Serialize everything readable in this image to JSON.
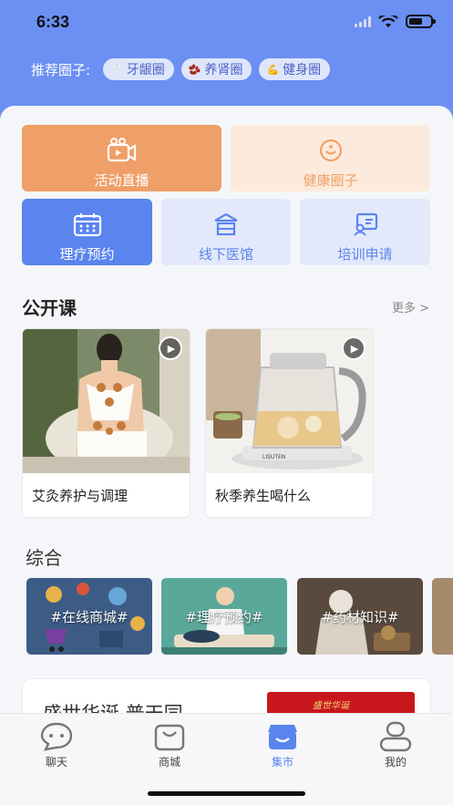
{
  "status_bar": {
    "time": "6:33"
  },
  "recommend": {
    "label": "推荐圈子:",
    "chips": [
      {
        "icon": "tooth-icon",
        "label": "牙龈圈"
      },
      {
        "icon": "kidney-icon",
        "label": "养肾圈"
      },
      {
        "icon": "fitness-icon",
        "label": "健身圈"
      }
    ]
  },
  "tiles": [
    {
      "label": "活动直播",
      "icon": "live-camera-icon"
    },
    {
      "label": "健康圈子",
      "icon": "smile-circle-icon"
    },
    {
      "label": "理疗预约",
      "icon": "calendar-icon"
    },
    {
      "label": "线下医馆",
      "icon": "clinic-icon"
    },
    {
      "label": "培训申请",
      "icon": "training-icon"
    }
  ],
  "open_course": {
    "title": "公开课",
    "more": "更多 >",
    "items": [
      {
        "title": "艾灸养护与调理"
      },
      {
        "title": "秋季养生喝什么"
      }
    ]
  },
  "general": {
    "title": "综合",
    "items": [
      {
        "label": "#在线商城#"
      },
      {
        "label": "#理疗预约#"
      },
      {
        "label": "#药材知识#"
      }
    ]
  },
  "news": {
    "title": "盛世华诞  普天同",
    "image_text": "盛世华诞"
  },
  "tabbar": {
    "items": [
      {
        "label": "聊天",
        "icon": "chat-icon"
      },
      {
        "label": "商城",
        "icon": "shop-bag-icon"
      },
      {
        "label": "集市",
        "icon": "market-icon"
      },
      {
        "label": "我的",
        "icon": "profile-icon"
      }
    ],
    "active_index": 2
  },
  "colors": {
    "header": "#6b8ff2",
    "accent": "#5a84ee",
    "orange": "#f0a06a"
  }
}
